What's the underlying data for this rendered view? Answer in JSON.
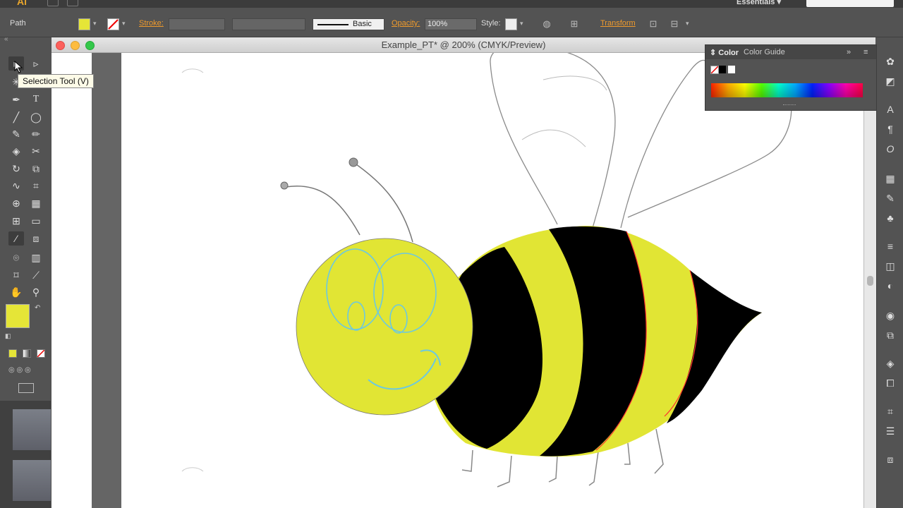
{
  "app": {
    "logo": "Ai",
    "workspace": "Essentials"
  },
  "control_bar": {
    "selection_type": "Path",
    "stroke_label": "Stroke:",
    "brush_label": "Basic",
    "opacity_label": "Opacity:",
    "opacity_value": "100%",
    "style_label": "Style:",
    "transform_label": "Transform",
    "fill_color": "#e5e537"
  },
  "document": {
    "title": "Example_PT* @ 200% (CMYK/Preview)"
  },
  "tooltip": "Selection Tool (V)",
  "color_panel": {
    "tab_color": "Color",
    "tab_guide": "Color Guide"
  },
  "colors": {
    "accent": "#f09b2c",
    "bee_yellow": "#e1e534",
    "bee_black": "#000000",
    "face_lines": "#6cc8e0",
    "path_selection": "#ff3030"
  },
  "icons": [
    "selection-icon",
    "direct-selection-icon",
    "magic-wand-icon",
    "lasso-icon",
    "pen-icon",
    "type-icon",
    "line-icon",
    "ellipse-icon",
    "paintbrush-icon",
    "pencil-icon",
    "eraser-icon",
    "scissors-icon",
    "rotate-icon",
    "scale-icon",
    "warp-icon",
    "free-transform-icon",
    "shape-builder-icon",
    "perspective-icon",
    "mesh-icon",
    "gradient-icon",
    "eyedropper-icon",
    "blend-icon",
    "symbol-sprayer-icon",
    "graph-icon",
    "artboard-icon",
    "slice-icon",
    "hand-icon",
    "zoom-icon"
  ]
}
